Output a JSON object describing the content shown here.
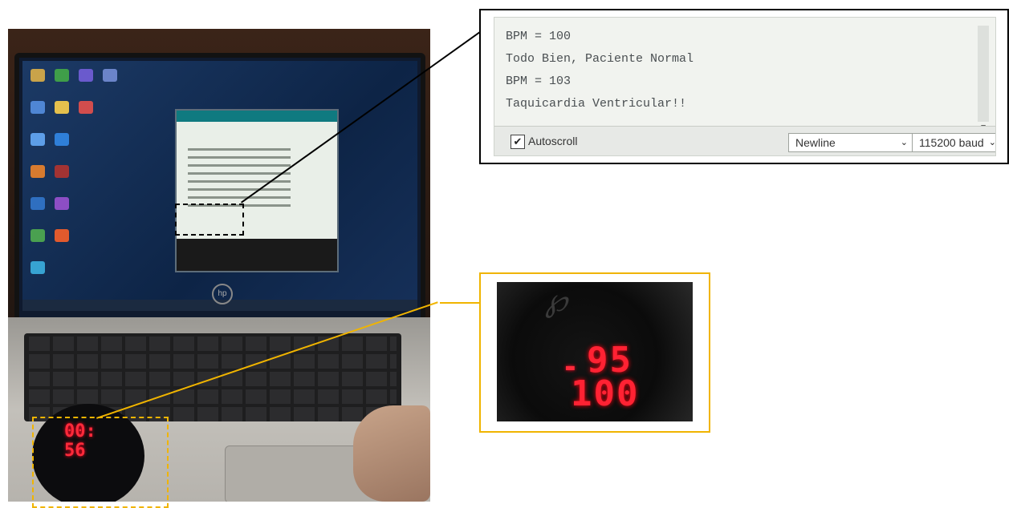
{
  "serial_monitor": {
    "lines": [
      "BPM = 100",
      "Todo Bien, Paciente Normal",
      "BPM = 103",
      "Taquicardia Ventricular!!"
    ],
    "autoscroll_label": "Autoscroll",
    "autoscroll_checked": true,
    "line_ending": "Newline",
    "baud_rate": "115200 baud"
  },
  "watch_display": {
    "top_value": "95",
    "bottom_value": "100"
  },
  "wrist_display": {
    "top_value": "00:",
    "bottom_value": "56"
  },
  "laptop": {
    "brand": "hp"
  },
  "colors": {
    "black_callout": "#000000",
    "yellow_callout": "#f0b400",
    "led_red": "#ff2233"
  }
}
